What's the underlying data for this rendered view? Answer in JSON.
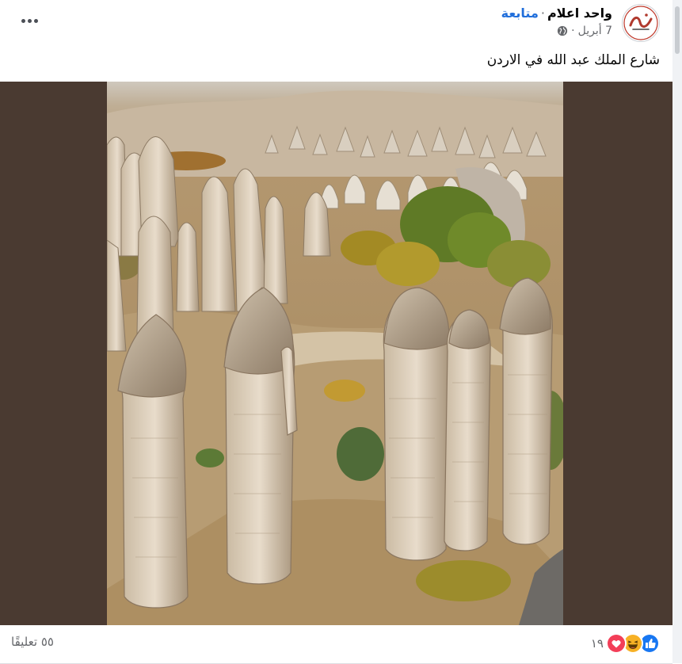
{
  "post": {
    "author": "واحد اعلام",
    "separator": "·",
    "follow_label": "متابعة",
    "date": "7 أبريل",
    "privacy_icon": "globe-icon",
    "text": "شارع الملك عبد الله في الاردن"
  },
  "footer": {
    "reaction_count": "١٩",
    "reactions": [
      "like-icon",
      "haha-icon",
      "love-icon"
    ],
    "comments_label": "٥٥ تعليقًا"
  },
  "colors": {
    "link_blue": "#216fdb",
    "secondary_text": "#65676b",
    "media_bg": "#4a3a31"
  }
}
